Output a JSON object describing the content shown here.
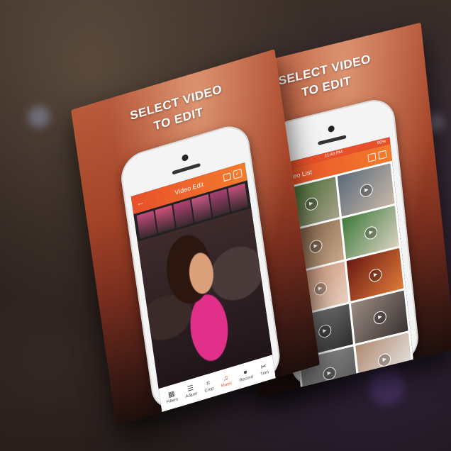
{
  "left_card": {
    "title_line1": "SELECT VIDEO",
    "title_line2": "TO EDIT",
    "screen": {
      "header_title": "Video Edit",
      "back_icon": "arrow-left-icon",
      "toolbar": [
        {
          "label": "Filters",
          "icon": "image-icon"
        },
        {
          "label": "Adjust",
          "icon": "sliders-icon"
        },
        {
          "label": "Crop",
          "icon": "crop-icon"
        },
        {
          "label": "Music",
          "icon": "music-note-icon",
          "active": true
        },
        {
          "label": "Record",
          "icon": "microphone-icon"
        },
        {
          "label": "Trim",
          "icon": "scissors-icon"
        }
      ]
    }
  },
  "right_card": {
    "title_line1": "SELECT VIDEO",
    "title_line2": "TO EDIT",
    "screen": {
      "status_time": "11:43 PM",
      "status_battery": "90%",
      "header_title": "Video List",
      "play_icon": "play-icon"
    }
  },
  "colors": {
    "accent": "#e8502a",
    "accent_light": "#f47b2c"
  }
}
